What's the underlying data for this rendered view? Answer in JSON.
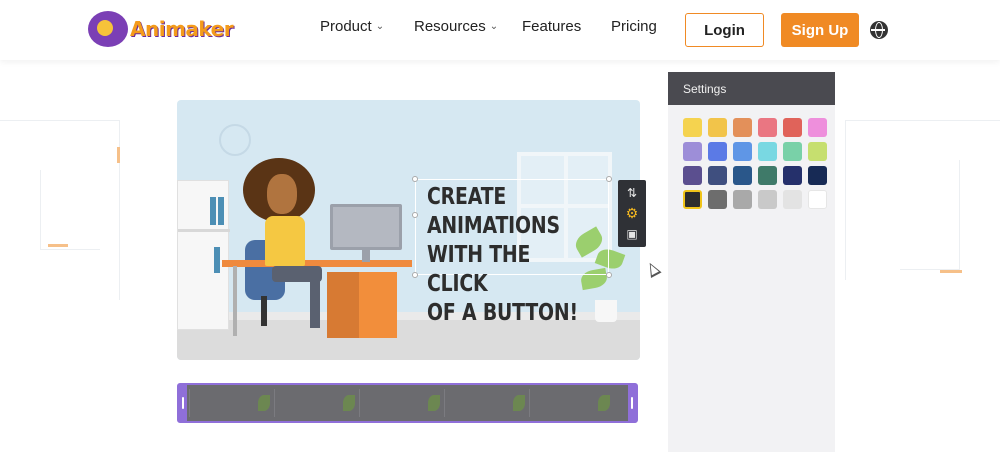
{
  "header": {
    "brand": "Animaker",
    "nav": [
      {
        "label": "Product",
        "has_dropdown": true
      },
      {
        "label": "Resources",
        "has_dropdown": true
      },
      {
        "label": "Features",
        "has_dropdown": false
      },
      {
        "label": "Pricing",
        "has_dropdown": false
      }
    ],
    "login_label": "Login",
    "signup_label": "Sign Up",
    "language_icon": "globe-icon"
  },
  "canvas": {
    "headline": [
      "CREATE ANIMATIONS",
      "WITH THE CLICK",
      "OF A BUTTON!"
    ],
    "toolbar_icons": [
      "swap-icon",
      "gear-icon",
      "trash-icon"
    ]
  },
  "settings": {
    "title": "Settings",
    "swatches": [
      "#f5d34f",
      "#f2c44a",
      "#e3905a",
      "#ea7682",
      "#e0635a",
      "#ee8fdc",
      "#9d8ed8",
      "#5b7ae6",
      "#5f96e6",
      "#79d8e2",
      "#79d1a8",
      "#c6df6f",
      "#5b4f8f",
      "#3f4f7f",
      "#2a578a",
      "#3f7a69",
      "#25306b",
      "#172a55",
      "#2d2d2d",
      "#6d6d6d",
      "#a9a9a9",
      "#c9c9c9",
      "#e3e3e3",
      "#ffffff"
    ],
    "selected_index": 18
  }
}
